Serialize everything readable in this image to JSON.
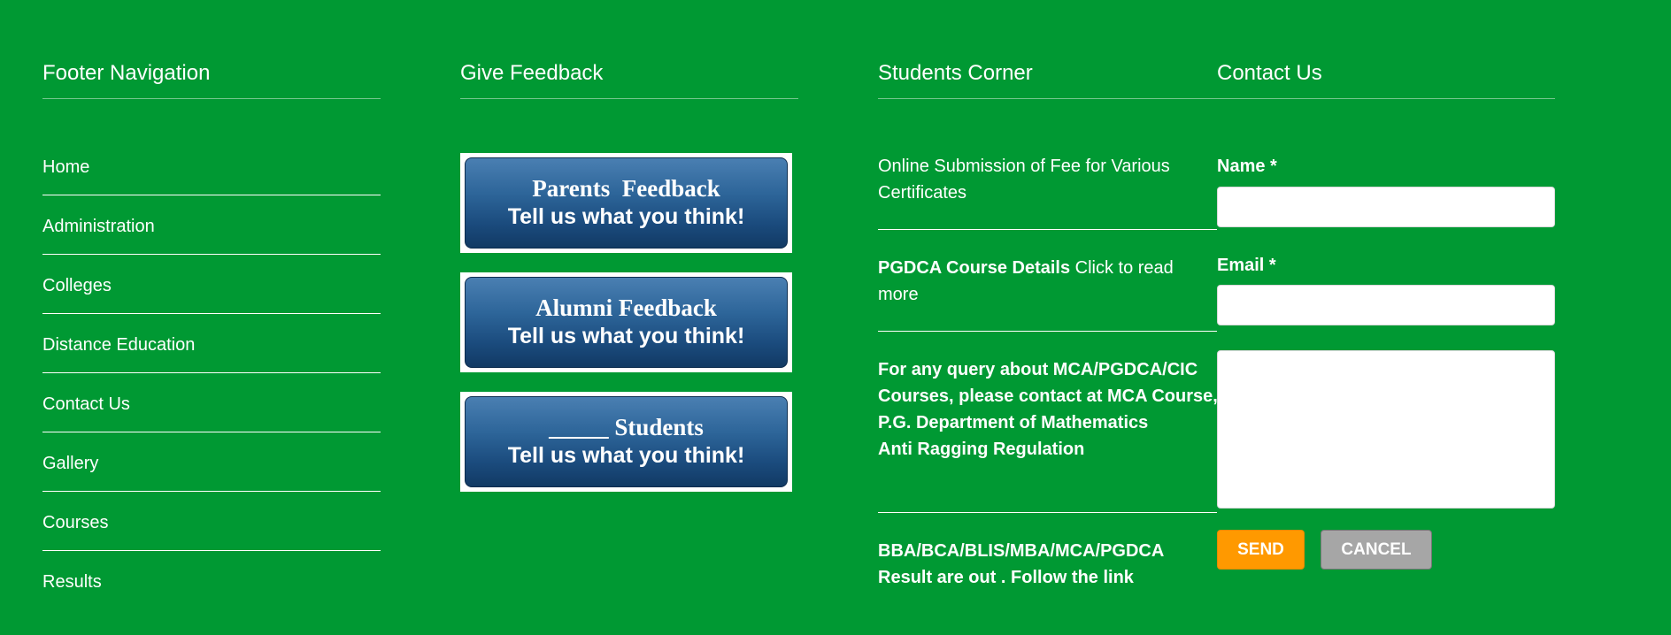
{
  "footer_nav": {
    "title": "Footer Navigation",
    "items": [
      {
        "label": "Home"
      },
      {
        "label": "Administration"
      },
      {
        "label": "Colleges"
      },
      {
        "label": "Distance Education"
      },
      {
        "label": "Contact Us"
      },
      {
        "label": "Gallery"
      },
      {
        "label": "Courses"
      },
      {
        "label": "Results"
      }
    ]
  },
  "feedback": {
    "title": "Give Feedback",
    "buttons": [
      {
        "title": "Parents  Feedback",
        "subtitle": "Tell us what you think!"
      },
      {
        "title": "Alumni Feedback",
        "subtitle": "Tell us what you think!"
      },
      {
        "title": "_____ Students",
        "subtitle": "Tell us what you think!"
      }
    ]
  },
  "students_corner": {
    "title": "Students Corner",
    "item1": "Online Submission of Fee for Various Certificates",
    "item2_bold": "PGDCA Course Details",
    "item2_rest": " Click to read more",
    "item3_line1": "For any query about MCA/PGDCA/CIC Courses, please contact at MCA Course, P.G. Department of Mathematics",
    "item3_line2": "Anti Ragging Regulation",
    "item4": "BBA/BCA/BLIS/MBA/MCA/PGDCA Result are out . Follow the link"
  },
  "contact": {
    "title": "Contact Us",
    "name_label": "Name *",
    "name_value": "",
    "email_label": "Email *",
    "email_value": "",
    "message_value": "",
    "send_label": "SEND",
    "cancel_label": "CANCEL"
  },
  "colors": {
    "background": "#009933",
    "send_button": "#ff9900",
    "cancel_button": "#a6a6a6",
    "feedback_button": "#2d6599"
  }
}
